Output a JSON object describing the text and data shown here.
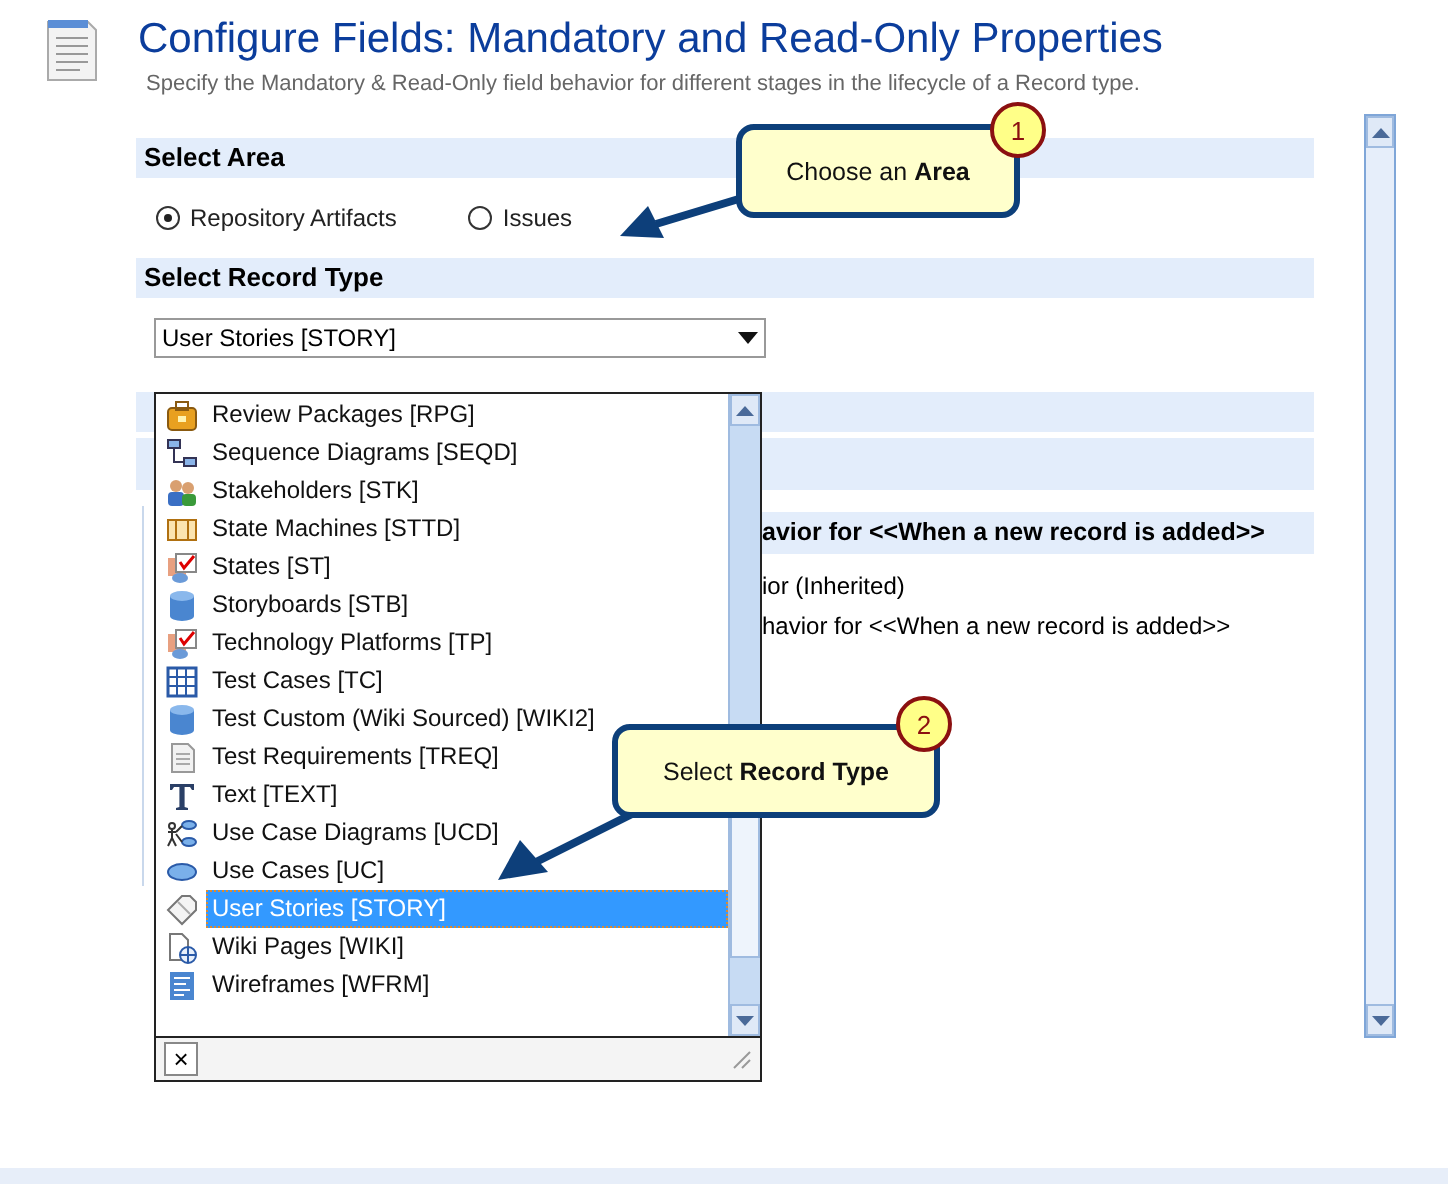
{
  "header": {
    "title": "Configure Fields: Mandatory and Read-Only Properties",
    "description": "Specify the Mandatory & Read-Only field behavior for different stages in the lifecycle of a Record type."
  },
  "sections": [
    {
      "kind": "area",
      "heading": "Select Area",
      "options": [
        {
          "label": "Repository Artifacts",
          "selected": true
        },
        {
          "label": "Issues",
          "selected": false
        }
      ]
    },
    {
      "kind": "record_type",
      "heading": "Select Record Type",
      "value": "User Stories [STORY]"
    }
  ],
  "behavior_heading": "avior for <<When a new record is added>>",
  "behavior_lines": [
    "ior (Inherited)",
    "havior for <<When a new record is added>>"
  ],
  "dropdown": {
    "close": "×",
    "items": [
      {
        "label": "Review Packages [RPG]",
        "kind": "package",
        "selected": false
      },
      {
        "label": "Sequence Diagrams [SEQD]",
        "kind": "sequence",
        "selected": false
      },
      {
        "label": "Stakeholders [STK]",
        "kind": "people",
        "selected": false
      },
      {
        "label": "State Machines [STTD]",
        "kind": "state-machine",
        "selected": false
      },
      {
        "label": "States [ST]",
        "kind": "checklist",
        "selected": false
      },
      {
        "label": "Storyboards [STB]",
        "kind": "cylinder",
        "selected": false
      },
      {
        "label": "Technology Platforms [TP]",
        "kind": "checklist",
        "selected": false
      },
      {
        "label": "Test Cases [TC]",
        "kind": "grid",
        "selected": false
      },
      {
        "label": "Test Custom (Wiki Sourced) [WIKI2]",
        "kind": "cylinder",
        "selected": false
      },
      {
        "label": "Test Requirements [TREQ]",
        "kind": "document",
        "selected": false
      },
      {
        "label": "Text [TEXT]",
        "kind": "text",
        "selected": false
      },
      {
        "label": "Use Case Diagrams [UCD]",
        "kind": "usecase-diagram",
        "selected": false
      },
      {
        "label": "Use Cases [UC]",
        "kind": "ellipse",
        "selected": false
      },
      {
        "label": "User Stories [STORY]",
        "kind": "tag",
        "selected": true
      },
      {
        "label": "Wiki Pages [WIKI]",
        "kind": "web-page",
        "selected": false
      },
      {
        "label": "Wireframes [WFRM]",
        "kind": "wireframe",
        "selected": false
      }
    ]
  },
  "callouts": [
    {
      "number": "1",
      "text": "Choose an **Area**"
    },
    {
      "number": "2",
      "text": "Select **Record Type**"
    }
  ]
}
